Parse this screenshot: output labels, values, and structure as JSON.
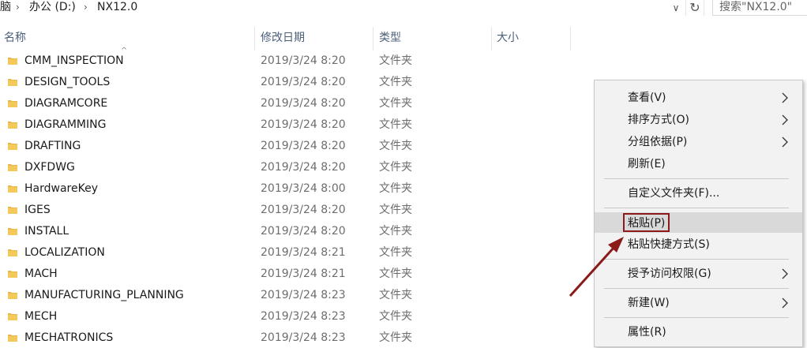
{
  "address": {
    "crumb_prefix": "脑",
    "crumb_drive": "办公 (D:)",
    "crumb_folder": "NX12.0",
    "search_placeholder": "搜索\"NX12.0\""
  },
  "columns": {
    "name": "名称",
    "date": "修改日期",
    "type": "类型",
    "size": "大小"
  },
  "rows": [
    {
      "name": "CMM_INSPECTION",
      "date": "2019/3/24 8:20",
      "type": "文件夹"
    },
    {
      "name": "DESIGN_TOOLS",
      "date": "2019/3/24 8:20",
      "type": "文件夹"
    },
    {
      "name": "DIAGRAMCORE",
      "date": "2019/3/24 8:20",
      "type": "文件夹"
    },
    {
      "name": "DIAGRAMMING",
      "date": "2019/3/24 8:20",
      "type": "文件夹"
    },
    {
      "name": "DRAFTING",
      "date": "2019/3/24 8:20",
      "type": "文件夹"
    },
    {
      "name": "DXFDWG",
      "date": "2019/3/24 8:20",
      "type": "文件夹"
    },
    {
      "name": "HardwareKey",
      "date": "2019/3/24 8:00",
      "type": "文件夹"
    },
    {
      "name": "IGES",
      "date": "2019/3/24 8:20",
      "type": "文件夹"
    },
    {
      "name": "INSTALL",
      "date": "2019/3/24 8:20",
      "type": "文件夹"
    },
    {
      "name": "LOCALIZATION",
      "date": "2019/3/24 8:21",
      "type": "文件夹"
    },
    {
      "name": "MACH",
      "date": "2019/3/24 8:21",
      "type": "文件夹"
    },
    {
      "name": "MANUFACTURING_PLANNING",
      "date": "2019/3/24 8:23",
      "type": "文件夹"
    },
    {
      "name": "MECH",
      "date": "2019/3/24 8:23",
      "type": "文件夹"
    },
    {
      "name": "MECHATRONICS",
      "date": "2019/3/24 8:23",
      "type": "文件夹"
    }
  ],
  "menu": {
    "view": "查看(V)",
    "sort": "排序方式(O)",
    "group": "分组依据(P)",
    "refresh": "刷新(E)",
    "customize": "自定义文件夹(F)...",
    "paste": "粘贴(P)",
    "paste_shortcut": "粘贴快捷方式(S)",
    "give_access": "授予访问权限(G)",
    "new": "新建(W)",
    "properties": "属性(R)"
  },
  "colors": {
    "folder": "#e8b94a",
    "highlight_box": "#8b1a1a",
    "arrow": "#8b1a1a"
  }
}
